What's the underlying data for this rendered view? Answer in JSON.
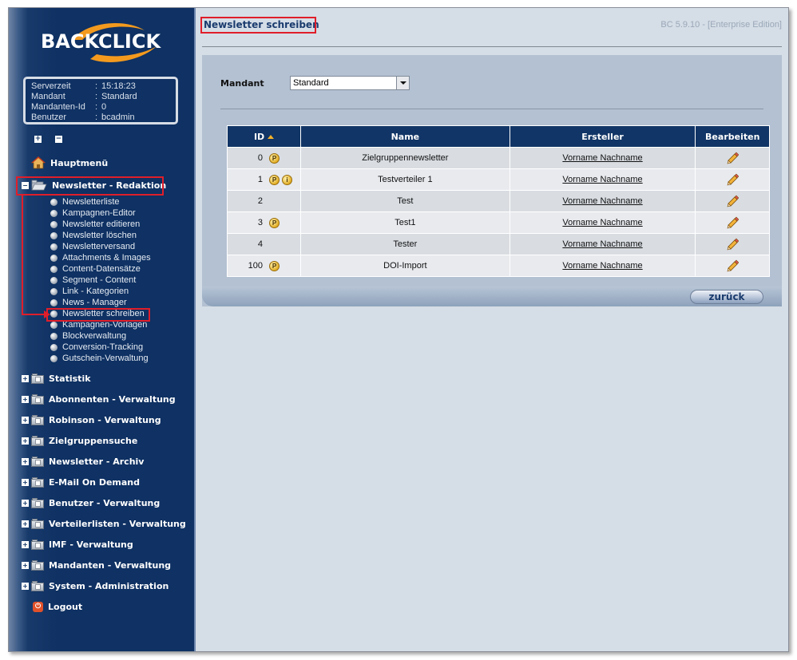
{
  "logo": {
    "text": "BACKCLICK"
  },
  "info": [
    {
      "key": "Serverzeit",
      "value": "15:18:23"
    },
    {
      "key": "Mandant",
      "value": "Standard"
    },
    {
      "key": "Mandanten-Id",
      "value": "0"
    },
    {
      "key": "Benutzer",
      "value": "bcadmin"
    }
  ],
  "nav": {
    "expand_all": "+",
    "collapse_all": "−",
    "home": "Hauptmenü",
    "section_open": "Newsletter - Redaktion",
    "section_open_toggle": "−",
    "sub_items": [
      "Newsletterliste",
      "Kampagnen-Editor",
      "Newsletter editieren",
      "Newsletter löschen",
      "Newsletterversand",
      "Attachments & Images",
      "Content-Datensätze",
      "Segment - Content",
      "Link - Kategorien",
      "News - Manager",
      "Newsletter schreiben",
      "Kampagnen-Vorlagen",
      "Blockverwaltung",
      "Conversion-Tracking",
      "Gutschein-Verwaltung"
    ],
    "sections": [
      "Statistik",
      "Abonnenten - Verwaltung",
      "Robinson - Verwaltung",
      "Zielgruppensuche",
      "Newsletter - Archiv",
      "E-Mail On Demand",
      "Benutzer - Verwaltung",
      "Verteilerlisten - Verwaltung",
      "IMF - Verwaltung",
      "Mandanten - Verwaltung",
      "System - Administration"
    ],
    "section_toggle": "+",
    "logout": "Logout"
  },
  "header": {
    "title": "Newsletter schreiben",
    "version": "BC 5.9.10 - [Enterprise Edition]"
  },
  "form": {
    "mandant_label": "Mandant",
    "mandant_value": "Standard"
  },
  "table": {
    "columns": [
      "ID",
      "Name",
      "Ersteller",
      "Bearbeiten"
    ],
    "rows": [
      {
        "id": "0",
        "badges": [
          "P"
        ],
        "name": "Zielgruppennewsletter",
        "creator": "Vorname Nachname"
      },
      {
        "id": "1",
        "badges": [
          "P",
          "i"
        ],
        "name": "Testverteiler 1",
        "creator": "Vorname Nachname"
      },
      {
        "id": "2",
        "badges": [],
        "name": "Test",
        "creator": "Vorname Nachname"
      },
      {
        "id": "3",
        "badges": [
          "P"
        ],
        "name": "Test1",
        "creator": "Vorname Nachname"
      },
      {
        "id": "4",
        "badges": [],
        "name": "Tester",
        "creator": "Vorname Nachname"
      },
      {
        "id": "100",
        "badges": [
          "P"
        ],
        "name": "DOI-Import",
        "creator": "Vorname Nachname"
      }
    ]
  },
  "actions": {
    "back": "zurück"
  },
  "colors": {
    "accent": "#e01e2a",
    "sidebar": "#0f3163",
    "header": "#113566",
    "logo_swoosh": "#f39a1e"
  }
}
